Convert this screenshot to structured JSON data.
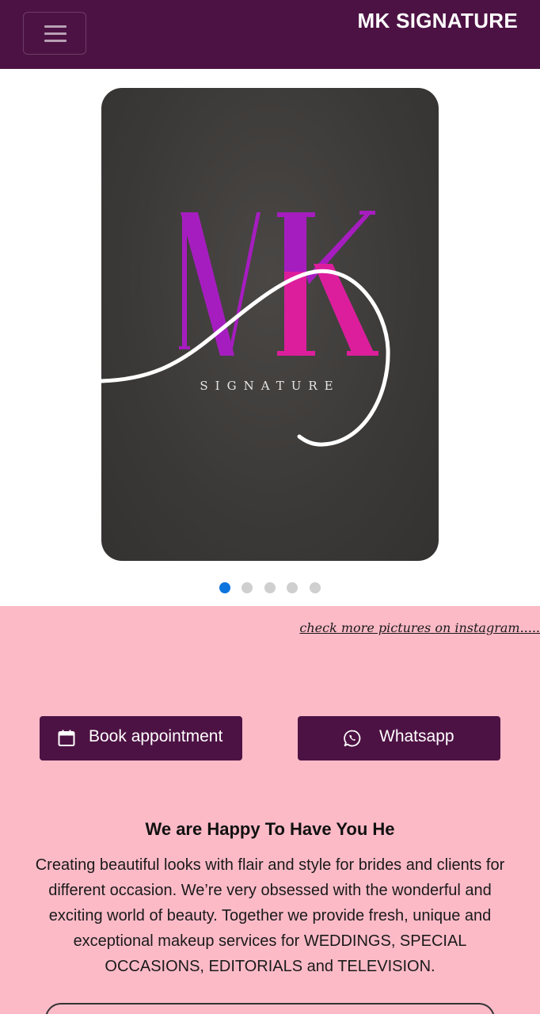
{
  "navbar": {
    "brand": "MK SIGNATURE",
    "menu_icon": "hamburger-icon",
    "background": "#4d1244"
  },
  "carousel": {
    "logo": {
      "letters": "MK",
      "tagline": "SIGNATURE"
    },
    "slide_count": 5,
    "active_index": 0,
    "active_color": "#0b74de"
  },
  "instagram_link": "check more pictures on instagram.....",
  "buttons": {
    "book": {
      "label": "Book appointment",
      "icon": "calendar-icon"
    },
    "whatsapp": {
      "label": "Whatsapp",
      "icon": "whatsapp-icon"
    }
  },
  "about": {
    "heading": "We are Happy To Have You He",
    "body": "Creating beautiful looks with flair and style for brides and clients for different occasion. We’re very obsessed with the wonderful and exciting world of beauty. Together we provide fresh, unique and exceptional makeup services for WEDDINGS, SPECIAL OCCASIONS, EDITORIALS and TELEVISION."
  },
  "colors": {
    "brand_purple": "#4d1244",
    "section_pink": "#fcbac7",
    "logo_violet": "#a61dbf",
    "logo_magenta": "#dc1e9c"
  }
}
